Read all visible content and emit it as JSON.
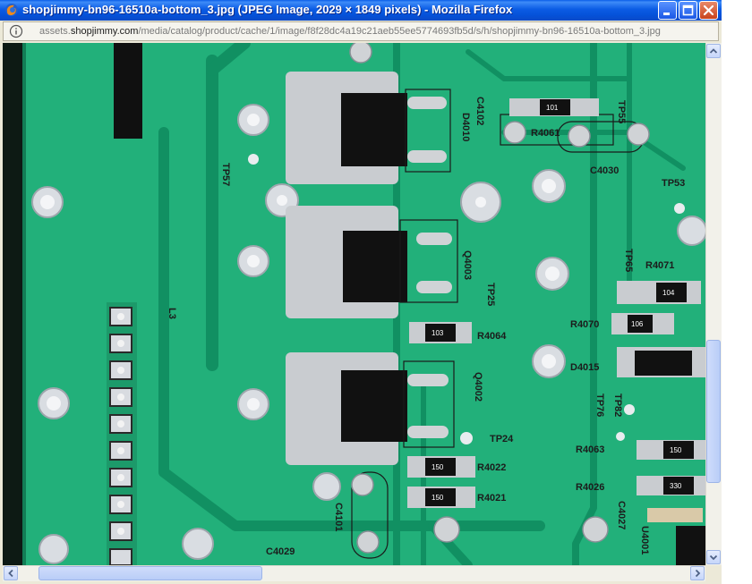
{
  "window": {
    "title": "shopjimmy-bn96-16510a-bottom_3.jpg (JPEG Image, 2029 × 1849 pixels) - Mozilla Firefox",
    "controls": {
      "minimize": "minimize-icon",
      "maximize": "maximize-icon",
      "close": "close-icon"
    }
  },
  "address": {
    "prefix": "assets.",
    "host": "shopjimmy.com",
    "path": "/media/catalog/product/cache/1/image/f8f28dc4a19c21aeb55ee5774693fb5d/s/h/shopjimmy-bn96-16510a-bottom_3.jpg",
    "icon": "site-info-icon"
  },
  "image": {
    "labels": {
      "tp57": "TP57",
      "d4010": "D4010",
      "q4003": "Q4003",
      "tp25": "TP25",
      "r4064": "R4064",
      "q4002": "Q4002",
      "tp24": "TP24",
      "r4022": "R4022",
      "r4021": "R4021",
      "c4101": "C4101",
      "c4029": "C4029",
      "l3": "L3",
      "c4102": "C4102",
      "tp55": "TP55",
      "r4061": "R4061",
      "c4030": "C4030",
      "tp53": "TP53",
      "tp65": "TP65",
      "r4071": "R4071",
      "r4070": "R4070",
      "d4015": "D4015",
      "tp76": "TP76",
      "tp82": "TP82",
      "r4063": "R4063",
      "r4026": "R4026",
      "c4027": "C4027",
      "u4001": "U4001"
    },
    "chip_codes": {
      "r101": "101",
      "r103": "103",
      "r104": "104",
      "r106": "106",
      "r150a": "150",
      "r150b": "150",
      "r150c": "150",
      "r330": "330"
    }
  },
  "colors": {
    "pcb": "#22b07a",
    "trace": "#119062",
    "pad": "#c9ccd0",
    "component": "#111111",
    "titlebar": "#0b5ce4"
  }
}
